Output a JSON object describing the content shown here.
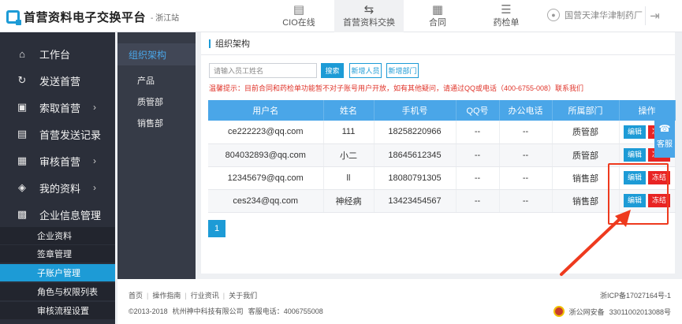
{
  "header": {
    "logo_title": "首营资料电子交换平台",
    "logo_sub": "- 浙江站",
    "tabs": [
      {
        "label": "CIO在线",
        "icon": "document-icon"
      },
      {
        "label": "首营资料交换",
        "icon": "exchange-icon"
      },
      {
        "label": "合同",
        "icon": "contract-icon"
      },
      {
        "label": "药检单",
        "icon": "list-icon"
      }
    ],
    "user_name": "国营天津华津制药厂"
  },
  "sidebar": {
    "items": [
      {
        "label": "工作台",
        "icon": "home-icon"
      },
      {
        "label": "发送首营",
        "icon": "send-icon"
      },
      {
        "label": "索取首营",
        "icon": "request-icon"
      },
      {
        "label": "首营发送记录",
        "icon": "record-icon"
      },
      {
        "label": "审核首营",
        "icon": "review-icon"
      },
      {
        "label": "我的资料",
        "icon": "layers-icon"
      },
      {
        "label": "企业信息管理",
        "icon": "building-icon"
      }
    ],
    "sub_items": [
      {
        "label": "企业资料"
      },
      {
        "label": "签章管理"
      },
      {
        "label": "子账户管理"
      },
      {
        "label": "角色与权限列表"
      },
      {
        "label": "审核流程设置"
      }
    ]
  },
  "org_tree": {
    "title": "组织架构",
    "nodes": [
      "产品",
      "质管部",
      "销售部"
    ]
  },
  "main": {
    "title": "组织架构",
    "search_placeholder": "请输入员工姓名",
    "search_label": "搜索",
    "add_person_label": "新增人员",
    "add_dept_label": "新增部门",
    "notice": "温馨提示：目前合同和药检单功能暂不对子账号用户开放，如有其他疑问，请通过QQ或电话（400-6755-008）联系我们",
    "columns": [
      "用户名",
      "姓名",
      "手机号",
      "QQ号",
      "办公电话",
      "所属部门",
      "操作"
    ],
    "edit_label": "编辑",
    "freeze_label": "冻结",
    "rows": [
      {
        "username": "ce222223@qq.com",
        "name": "111",
        "phone": "18258220966",
        "qq": "--",
        "office": "--",
        "dept": "质管部"
      },
      {
        "username": "804032893@qq.com",
        "name": "小二",
        "phone": "18645612345",
        "qq": "--",
        "office": "--",
        "dept": "质管部"
      },
      {
        "username": "12345679@qq.com",
        "name": "ll",
        "phone": "18080791305",
        "qq": "--",
        "office": "--",
        "dept": "销售部"
      },
      {
        "username": "ces234@qq.com",
        "name": "神经病",
        "phone": "13423454567",
        "qq": "--",
        "office": "--",
        "dept": "销售部"
      }
    ],
    "page": "1"
  },
  "service_label": "客服",
  "footer": {
    "links": [
      "首页",
      "操作指南",
      "行业资讯",
      "关于我们"
    ],
    "copyright": "©2013-2018",
    "company": "杭州神中科技有限公司",
    "hotline": "客服电话：4006755008",
    "icp": "浙ICP备17027164号-1",
    "police": "浙公网安备",
    "police_no": "33011002013088号"
  }
}
